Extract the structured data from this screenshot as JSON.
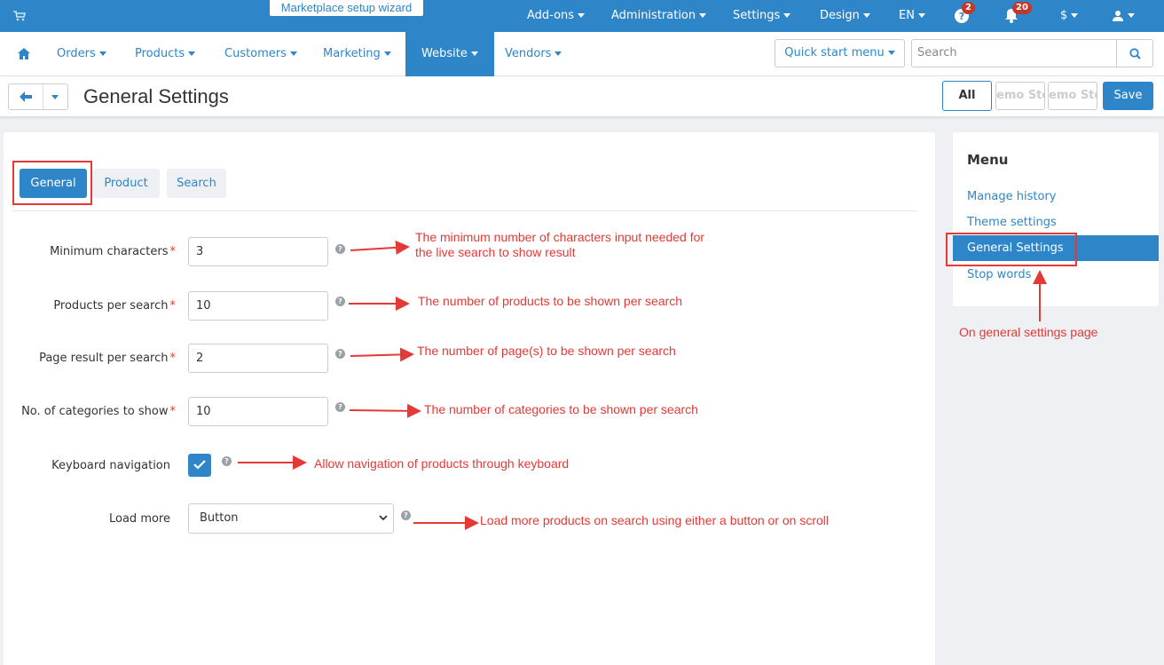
{
  "topbar": {
    "wizard_label": "Marketplace setup wizard",
    "menus": [
      "Add-ons",
      "Administration",
      "Settings",
      "Design",
      "EN"
    ],
    "help_badge": "2",
    "notifications_badge": "20",
    "currency": "$"
  },
  "navbar": {
    "items": [
      "Orders",
      "Products",
      "Customers",
      "Marketing",
      "Website",
      "Vendors"
    ],
    "active_item": "Website",
    "quick_start_label": "Quick start menu",
    "search_placeholder": "Search"
  },
  "titlebar": {
    "title": "General Settings",
    "all_label": "All",
    "store_labels": [
      "emo Sto",
      "emo Sto"
    ],
    "save_label": "Save"
  },
  "tabs": [
    "General",
    "Product",
    "Search"
  ],
  "active_tab": "General",
  "fields": [
    {
      "label": "Minimum characters",
      "value": "3",
      "required": "*"
    },
    {
      "label": "Products per search",
      "value": "10",
      "required": "*"
    },
    {
      "label": "Page result per search",
      "value": "2",
      "required": "*"
    },
    {
      "label": "No. of categories to show",
      "value": "10",
      "required": "*"
    },
    {
      "label": "Keyboard navigation",
      "checked": true
    },
    {
      "label": "Load more",
      "value": "Button"
    }
  ],
  "annotations": {
    "min_chars_line1": "The minimum number of characters input needed for",
    "min_chars_line2": "the live search to show result",
    "products_per_search": "The number of products to be shown per search",
    "page_result": "The number of page(s) to be shown per search",
    "categories": "The number of categories to be shown per search",
    "keyboard": "Allow navigation of products through keyboard",
    "load_more": "Load more products on search using either a button or on scroll",
    "sidebar_note": "On general settings page"
  },
  "sidebar": {
    "title": "Menu",
    "items": [
      "Manage history",
      "Theme settings",
      "General Settings",
      "Stop words"
    ],
    "active_item": "General Settings"
  },
  "colors": {
    "primary": "#2e86c9",
    "annotation": "#e53935",
    "background": "#eef0f3"
  }
}
